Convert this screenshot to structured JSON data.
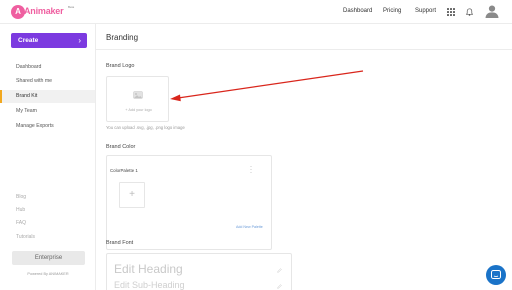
{
  "header": {
    "logo_badge": "A",
    "logo_text": "Animaker",
    "logo_sup": "Beta",
    "nav": [
      "Dashboard",
      "Pricing",
      "Support"
    ]
  },
  "sidebar": {
    "create_label": "Create",
    "create_chevron": "›",
    "items": [
      {
        "label": "Dashboard"
      },
      {
        "label": "Shared with me"
      },
      {
        "label": "Brand Kit"
      },
      {
        "label": "My Team"
      },
      {
        "label": "Manage Exports"
      }
    ],
    "links": [
      "Blog",
      "Hub",
      "FAQ",
      "Tutorials"
    ],
    "enterprise_label": "Enterprise",
    "powered_by": "Powered By ANIMAKER"
  },
  "main": {
    "title": "Branding",
    "brand_logo": {
      "label": "Brand Logo",
      "add_text": "+ Add your logo",
      "hint": "You can upload .svg, .jpg, .png logo image"
    },
    "brand_color": {
      "label": "Brand Color",
      "palette_name": "ColorPalette 1",
      "add_swatch": "+",
      "add_palette": "Add New Palette"
    },
    "brand_font": {
      "label": "Brand Font",
      "heading": "Edit Heading",
      "subheading": "Edit Sub-Heading"
    }
  },
  "colors": {
    "accent": "#7c3ae0",
    "active_marker": "#f2a81f",
    "logo_pink": "#ef5fa0",
    "arrow": "#d9261c",
    "chat": "#1a73c8"
  }
}
